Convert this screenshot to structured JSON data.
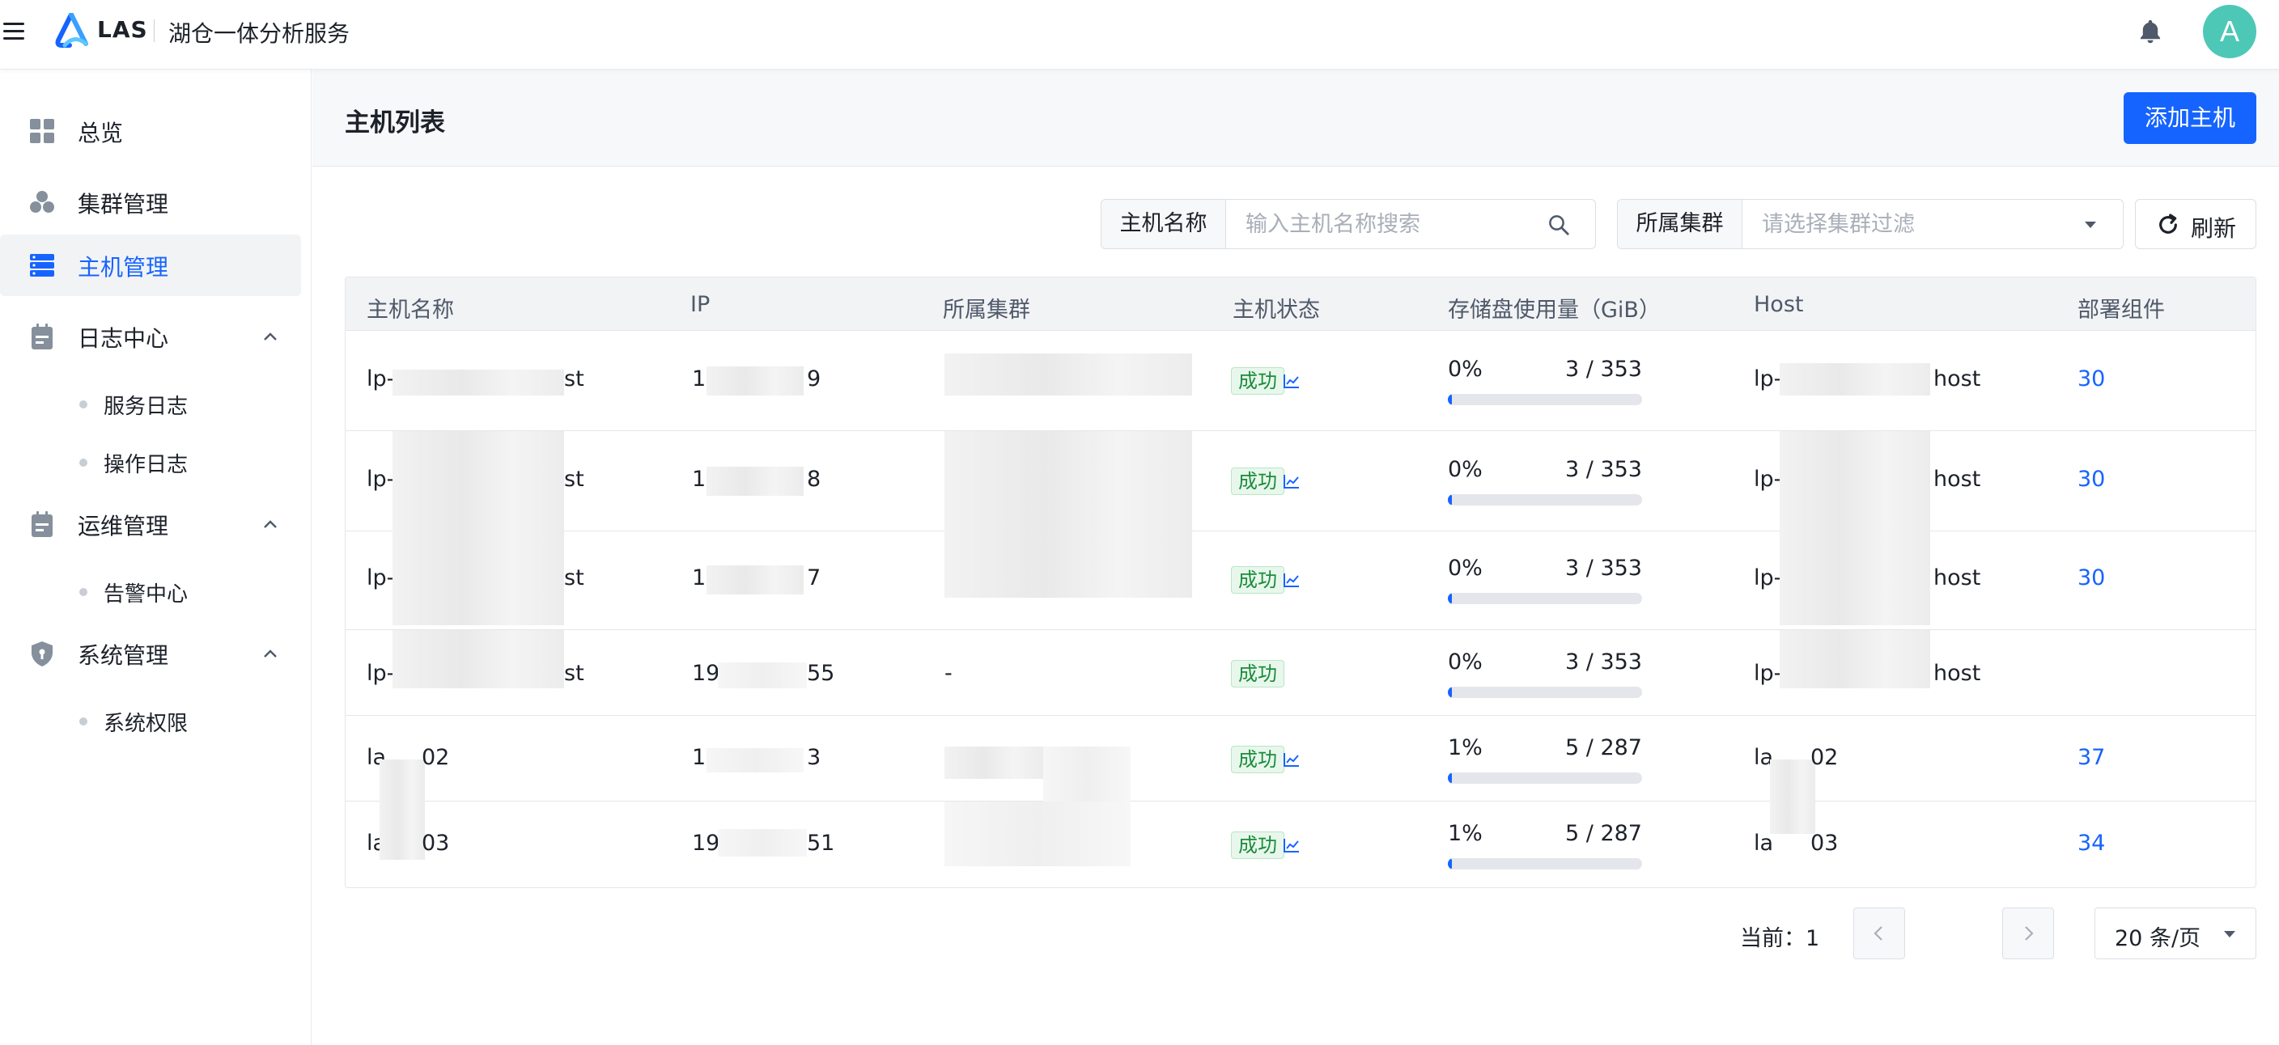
{
  "header": {
    "brand": "LAS",
    "subtitle": "湖仓一体分析服务",
    "avatar_letter": "A"
  },
  "sidebar": {
    "items": [
      {
        "label": "总览",
        "icon": "dashboard-icon"
      },
      {
        "label": "集群管理",
        "icon": "cluster-icon"
      },
      {
        "label": "主机管理",
        "icon": "host-icon",
        "active": true
      },
      {
        "label": "日志中心",
        "icon": "clipboard-icon",
        "expanded": true,
        "children": [
          "服务日志",
          "操作日志"
        ]
      },
      {
        "label": "运维管理",
        "icon": "clipboard-icon",
        "expanded": true,
        "children": [
          "告警中心"
        ]
      },
      {
        "label": "系统管理",
        "icon": "shield-icon",
        "expanded": true,
        "children": [
          "系统权限"
        ]
      }
    ]
  },
  "page": {
    "title": "主机列表",
    "add_button": "添加主机"
  },
  "filters": {
    "host_name_label": "主机名称",
    "host_name_placeholder": "输入主机名称搜索",
    "cluster_label": "所属集群",
    "cluster_placeholder": "请选择集群过滤",
    "refresh_label": "刷新"
  },
  "table": {
    "columns": [
      "主机名称",
      "IP",
      "所属集群",
      "主机状态",
      "存储盘使用量（GiB）",
      "Host",
      "部署组件"
    ],
    "rows": [
      {
        "name_prefix": "lp-",
        "name_suffix": "st",
        "ip_prefix": "1",
        "ip_prefix2": "9",
        "ip_suffix": "9",
        "cluster": "",
        "status": "成功",
        "has_trend": true,
        "usage_pct": "0%",
        "usage_ratio": "3 / 353",
        "usage_fill": 0.01,
        "host_prefix": "lp-",
        "host_suffix": "host",
        "components": "30"
      },
      {
        "name_prefix": "lp-",
        "name_suffix": "st",
        "ip_prefix": "1",
        "ip_prefix2": "",
        "ip_suffix": "8",
        "cluster": "",
        "status": "成功",
        "has_trend": true,
        "usage_pct": "0%",
        "usage_ratio": "3 / 353",
        "usage_fill": 0.01,
        "host_prefix": "lp-",
        "host_suffix": "host",
        "components": "30"
      },
      {
        "name_prefix": "lp-",
        "name_suffix": "st",
        "ip_prefix": "1",
        "ip_prefix2": "",
        "ip_suffix": "7",
        "cluster": "",
        "status": "成功",
        "has_trend": true,
        "usage_pct": "0%",
        "usage_ratio": "3 / 353",
        "usage_fill": 0.01,
        "host_prefix": "lp-",
        "host_suffix": "host",
        "components": "30"
      },
      {
        "name_prefix": "lp-",
        "name_suffix": "st",
        "ip_prefix": "19",
        "ip_prefix2": "",
        "ip_suffix": "55",
        "cluster": "-",
        "status": "成功",
        "has_trend": false,
        "usage_pct": "0%",
        "usage_ratio": "3 / 353",
        "usage_fill": 0.01,
        "host_prefix": "lp-",
        "host_suffix": "host",
        "components": ""
      },
      {
        "name_prefix": "la",
        "name_suffix": "02",
        "ip_prefix": "1",
        "ip_prefix2": "",
        "ip_suffix": "3",
        "cluster": "",
        "status": "成功",
        "has_trend": true,
        "usage_pct": "1%",
        "usage_ratio": "5 / 287",
        "usage_fill": 0.02,
        "host_prefix": "la",
        "host_suffix": "02",
        "components": "37"
      },
      {
        "name_prefix": "la",
        "name_suffix": "03",
        "ip_prefix": "19",
        "ip_prefix2": "",
        "ip_suffix": "51",
        "cluster": "",
        "status": "成功",
        "has_trend": true,
        "usage_pct": "1%",
        "usage_ratio": "5 / 287",
        "usage_fill": 0.02,
        "host_prefix": "la",
        "host_suffix": "03",
        "components": "34"
      }
    ]
  },
  "pagination": {
    "current_label": "当前：",
    "current_page": "1",
    "page_size": "20 条/页"
  },
  "colors": {
    "primary": "#1664ff",
    "success_text": "#1a8c3a",
    "success_bg": "#e8f7ec",
    "avatar": "#4dc8b6"
  }
}
